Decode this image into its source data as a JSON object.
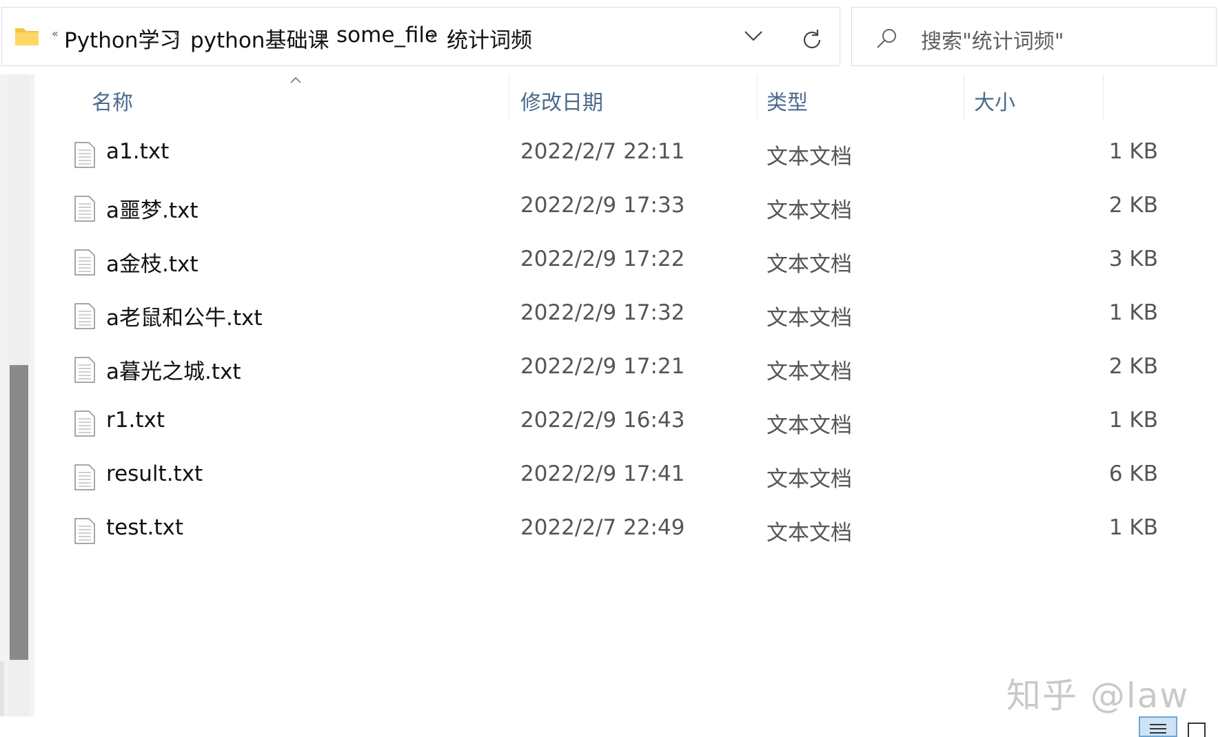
{
  "address_bar": {
    "overflow_chevron": "«",
    "breadcrumbs": [
      "Python学习",
      "python基础课",
      "some_file",
      "统计词频"
    ],
    "folder_icon": "folder-icon",
    "dropdown_icon": "chevron-down-icon",
    "refresh_icon": "refresh-icon"
  },
  "search": {
    "placeholder": "搜索\"统计词频\"",
    "icon": "search-icon"
  },
  "columns": {
    "name": "名称",
    "modified": "修改日期",
    "type": "类型",
    "size": "大小"
  },
  "files": [
    {
      "name": "a1.txt",
      "modified": "2022/2/7 22:11",
      "type": "文本文档",
      "size": "1 KB"
    },
    {
      "name": "a噩梦.txt",
      "modified": "2022/2/9 17:33",
      "type": "文本文档",
      "size": "2 KB"
    },
    {
      "name": "a金枝.txt",
      "modified": "2022/2/9 17:22",
      "type": "文本文档",
      "size": "3 KB"
    },
    {
      "name": "a老鼠和公牛.txt",
      "modified": "2022/2/9 17:32",
      "type": "文本文档",
      "size": "1 KB"
    },
    {
      "name": "a暮光之城.txt",
      "modified": "2022/2/9 17:21",
      "type": "文本文档",
      "size": "2 KB"
    },
    {
      "name": "r1.txt",
      "modified": "2022/2/9 16:43",
      "type": "文本文档",
      "size": "1 KB"
    },
    {
      "name": "result.txt",
      "modified": "2022/2/9 17:41",
      "type": "文本文档",
      "size": "6 KB"
    },
    {
      "name": "test.txt",
      "modified": "2022/2/7 22:49",
      "type": "文本文档",
      "size": "1 KB"
    }
  ],
  "watermark": "知乎 @law",
  "colors": {
    "header_text": "#4b6a8c",
    "folder": "#f2c53d",
    "scroll_thumb": "#8a8a8a",
    "view_active": "#cfe3f5"
  }
}
